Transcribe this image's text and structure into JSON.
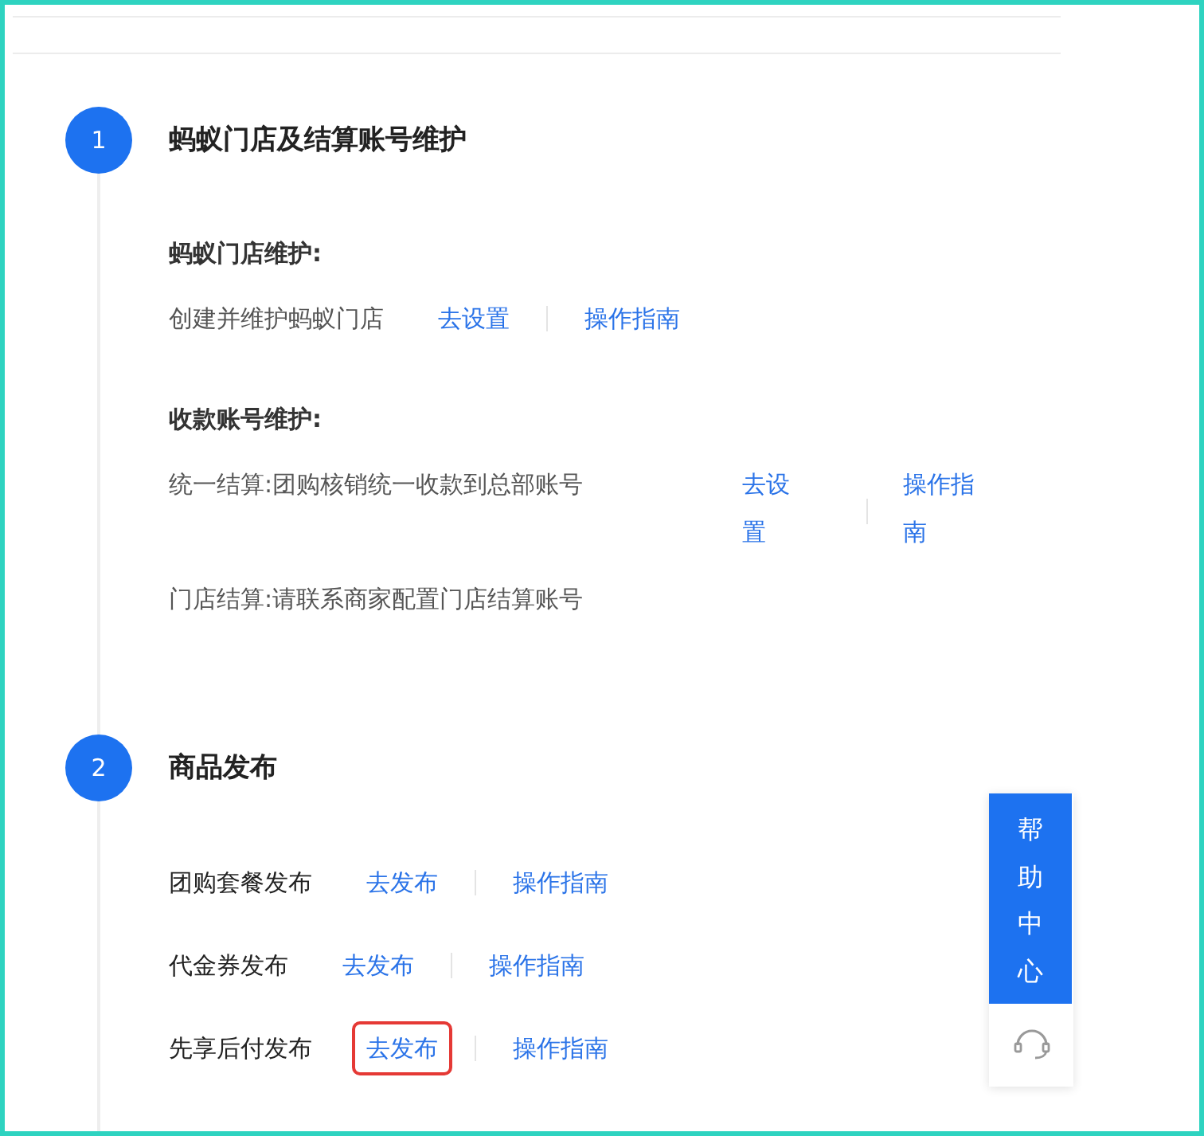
{
  "steps": [
    {
      "number": "1",
      "title": "蚂蚁门店及结算账号维护",
      "groups": [
        {
          "heading": "蚂蚁门店维护:",
          "rows": [
            {
              "kind": "inline",
              "text": "创建并维护蚂蚁门店",
              "links": [
                {
                  "label": "去设置",
                  "highlighted": false
                },
                {
                  "label": "操作指南",
                  "highlighted": false
                }
              ]
            }
          ]
        },
        {
          "heading": "收款账号维护:",
          "rows": [
            {
              "kind": "columns",
              "text": "统一结算:团购核销统一收款到总部账号",
              "links": [
                {
                  "label": "去设置",
                  "highlighted": false
                },
                {
                  "label": "操作指南",
                  "highlighted": false
                }
              ]
            },
            {
              "kind": "inline",
              "text": "门店结算:请联系商家配置门店结算账号",
              "links": []
            }
          ]
        }
      ]
    },
    {
      "number": "2",
      "title": "商品发布",
      "groups": [
        {
          "rows": [
            {
              "kind": "label",
              "text": "团购套餐发布",
              "links": [
                {
                  "label": "去发布",
                  "highlighted": false
                },
                {
                  "label": "操作指南",
                  "highlighted": false
                }
              ]
            },
            {
              "kind": "label",
              "text": "代金券发布",
              "links": [
                {
                  "label": "去发布",
                  "highlighted": false
                },
                {
                  "label": "操作指南",
                  "highlighted": false
                }
              ]
            },
            {
              "kind": "label",
              "text": "先享后付发布",
              "links": [
                {
                  "label": "去发布",
                  "highlighted": true
                },
                {
                  "label": "操作指南",
                  "highlighted": false
                }
              ]
            }
          ]
        }
      ]
    }
  ],
  "help": {
    "label": "帮助中心"
  }
}
